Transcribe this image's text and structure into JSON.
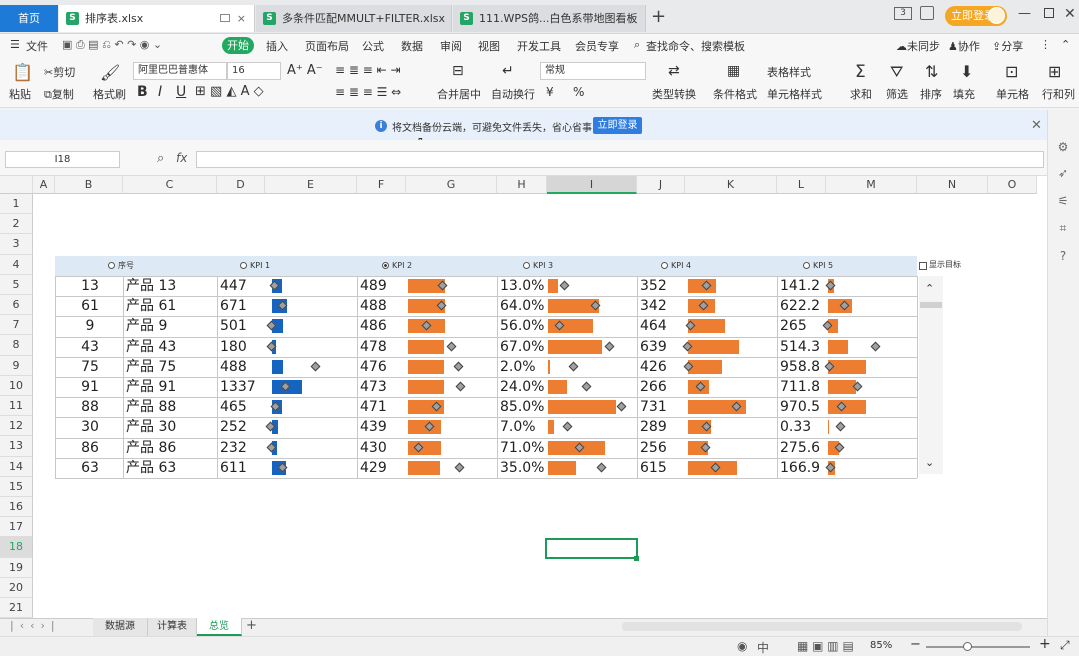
{
  "titlebar": {
    "home": "首页",
    "tabs": [
      "排序表.xlsx",
      "多条件匹配MMULT+FILTER.xlsx",
      "111.WPS鸽...白色系带地图看板"
    ],
    "login": "立即登录",
    "badge": "3"
  },
  "menu": {
    "file": "文件",
    "start": "开始",
    "items": [
      "插入",
      "页面布局",
      "公式",
      "数据",
      "审阅",
      "视图",
      "开发工具",
      "会员专享"
    ],
    "search": "查找命令、搜索模板",
    "unsync": "未同步",
    "collab": "协作",
    "share": "分享"
  },
  "toolbar": {
    "cut": "剪切",
    "copy": "复制",
    "paste": "粘贴",
    "format_painter": "格式刷",
    "font": "阿里巴巴普惠体",
    "size": "16",
    "merge": "合并居中",
    "wrap": "自动换行",
    "numfmt": "常规",
    "convert": "类型转换",
    "cond": "条件格式",
    "tablestyle": "表格样式",
    "cellstyle": "单元格样式",
    "sum": "求和",
    "filter": "筛选",
    "sort": "排序",
    "fill": "填充",
    "cell": "单元格",
    "rowcol": "行和列",
    "bold": "B",
    "italic": "I",
    "underline": "U",
    "currency": "¥",
    "percent": "%"
  },
  "notify": {
    "text": "将文档备份云端，可避免文件丢失，省心省事",
    "button": "立即登录"
  },
  "formula": {
    "cellref": "I18",
    "fx": "fx"
  },
  "columns": [
    "A",
    "B",
    "C",
    "D",
    "E",
    "F",
    "G",
    "H",
    "I",
    "J",
    "K",
    "L",
    "M",
    "N",
    "O"
  ],
  "rows": [
    "1",
    "2",
    "3",
    "4",
    "5",
    "6",
    "7",
    "8",
    "9",
    "10",
    "11",
    "12",
    "13",
    "14",
    "15",
    "16",
    "17",
    "18",
    "19",
    "20",
    "21"
  ],
  "dashboard": {
    "headers": {
      "seq": "序号",
      "kpi1": "KPI 1",
      "kpi2": "KPI 2",
      "kpi3": "KPI 3",
      "kpi4": "KPI 4",
      "kpi5": "KPI 5"
    },
    "show_target": "显示目标",
    "selected_kpi": "KPI 2",
    "rows": [
      {
        "id": "13",
        "name": "产品 13",
        "k1": "447",
        "k2": "489",
        "k3": "13.0%",
        "k4": "352",
        "k5": "141.2"
      },
      {
        "id": "61",
        "name": "产品 61",
        "k1": "671",
        "k2": "488",
        "k3": "64.0%",
        "k4": "342",
        "k5": "622.2"
      },
      {
        "id": "9",
        "name": "产品 9",
        "k1": "501",
        "k2": "486",
        "k3": "56.0%",
        "k4": "464",
        "k5": "265"
      },
      {
        "id": "43",
        "name": "产品 43",
        "k1": "180",
        "k2": "478",
        "k3": "67.0%",
        "k4": "639",
        "k5": "514.3"
      },
      {
        "id": "75",
        "name": "产品 75",
        "k1": "488",
        "k2": "476",
        "k3": "2.0%",
        "k4": "426",
        "k5": "958.8"
      },
      {
        "id": "91",
        "name": "产品 91",
        "k1": "1337",
        "k2": "473",
        "k3": "24.0%",
        "k4": "266",
        "k5": "711.8"
      },
      {
        "id": "88",
        "name": "产品 88",
        "k1": "465",
        "k2": "471",
        "k3": "85.0%",
        "k4": "731",
        "k5": "970.5"
      },
      {
        "id": "30",
        "name": "产品 30",
        "k1": "252",
        "k2": "439",
        "k3": "7.0%",
        "k4": "289",
        "k5": "0.33"
      },
      {
        "id": "86",
        "name": "产品 86",
        "k1": "232",
        "k2": "430",
        "k3": "71.0%",
        "k4": "256",
        "k5": "275.6"
      },
      {
        "id": "63",
        "name": "产品 63",
        "k1": "611",
        "k2": "429",
        "k3": "35.0%",
        "k4": "615",
        "k5": "166.9"
      }
    ]
  },
  "colors": {
    "kpi1_bar": "#1565c0",
    "other_bar": "#ed7d31",
    "accent": "#22a85f"
  },
  "sheets": {
    "tabs": [
      "数据源",
      "计算表",
      "总览"
    ],
    "active": "总览"
  },
  "status": {
    "zoom": "85%"
  }
}
